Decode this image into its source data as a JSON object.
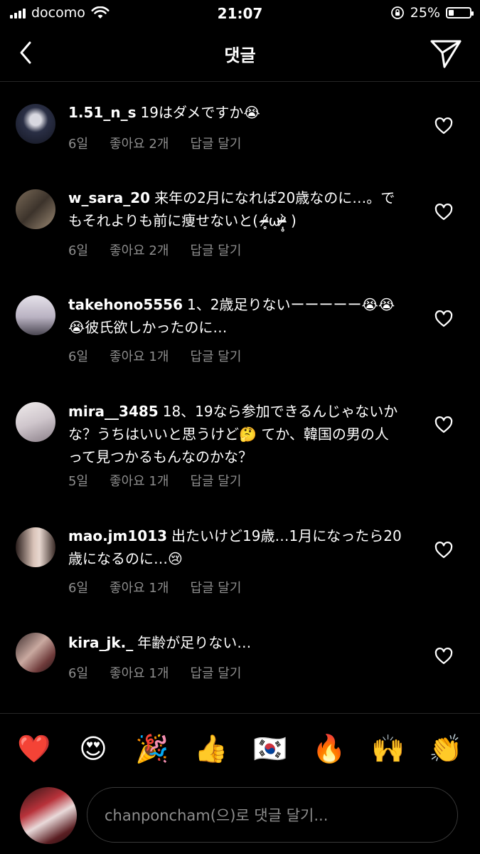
{
  "status": {
    "carrier": "docomo",
    "time": "21:07",
    "battery_percent": "25%",
    "battery_level": 0.25
  },
  "header": {
    "title": "댓글"
  },
  "comments": [
    {
      "username": "1.51_n_s",
      "text": "19はダメですか😭",
      "time": "6일",
      "likes": "좋아요 2개",
      "reply": "답글 달기"
    },
    {
      "username": "w_sara_20",
      "text": "来年の2月になれば20歳なのに…。でもそれよりも前に痩せないと( ᵒ̴̶̷̥́ωᵒ̴̶̷̣̥̀ )",
      "time": "6일",
      "likes": "좋아요 2개",
      "reply": "답글 달기"
    },
    {
      "username": "takehono5556",
      "text": "1、2歳足りないーーーーー😭😭😭彼氏欲しかったのに…",
      "time": "6일",
      "likes": "좋아요 1개",
      "reply": "답글 달기"
    },
    {
      "username": "mira__3485",
      "text": "18、19なら参加できるんじゃないかな？うちはいいと思うけど🤔 てか、韓国の男の人って見つかるもんなのかな？",
      "time": "5일",
      "likes": "좋아요 1개",
      "reply": "답글 달기"
    },
    {
      "username": "mao.jm1013",
      "text": "出たいけど19歳…1月になったら20歳になるのに…😢",
      "time": "6일",
      "likes": "좋아요 1개",
      "reply": "답글 달기"
    },
    {
      "username": "kira_jk._",
      "text": "年齢が足りない…",
      "time": "6일",
      "likes": "좋아요 1개",
      "reply": "답글 달기"
    }
  ],
  "reactions": [
    "❤️",
    "😍",
    "🎉",
    "👍",
    "🇰🇷",
    "🔥",
    "🙌",
    "👏"
  ],
  "composer": {
    "placeholder": "chanponcham(으)로 댓글 달기...",
    "value": ""
  }
}
